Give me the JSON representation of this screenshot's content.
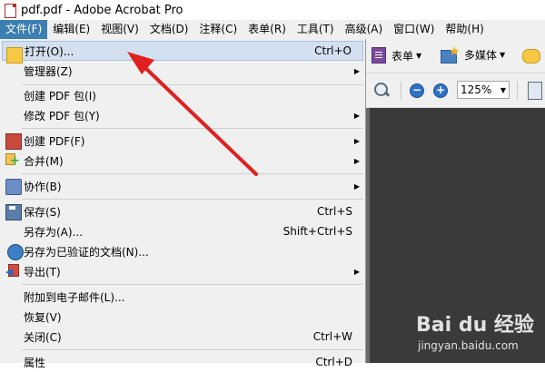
{
  "window": {
    "title": "pdf.pdf - Adobe Acrobat Pro"
  },
  "menubar": {
    "items": [
      {
        "label": "文件(F)"
      },
      {
        "label": "编辑(E)"
      },
      {
        "label": "视图(V)"
      },
      {
        "label": "文档(D)"
      },
      {
        "label": "注释(C)"
      },
      {
        "label": "表单(R)"
      },
      {
        "label": "工具(T)"
      },
      {
        "label": "高级(A)"
      },
      {
        "label": "窗口(W)"
      },
      {
        "label": "帮助(H)"
      }
    ]
  },
  "file_menu": {
    "items": [
      {
        "label": "打开(O)...",
        "shortcut": "Ctrl+O",
        "icon": "folder-icon"
      },
      {
        "label": "管理器(Z)",
        "submenu": true
      },
      {
        "label": "创建 PDF 包(I)"
      },
      {
        "label": "修改 PDF 包(Y)",
        "submenu": true
      },
      {
        "label": "创建 PDF(F)",
        "submenu": true,
        "icon": "create-pdf-icon"
      },
      {
        "label": "合并(M)",
        "submenu": true,
        "icon": "merge-icon"
      },
      {
        "label": "协作(B)",
        "submenu": true,
        "icon": "collaborate-icon"
      },
      {
        "label": "保存(S)",
        "shortcut": "Ctrl+S",
        "icon": "save-icon"
      },
      {
        "label": "另存为(A)...",
        "shortcut": "Shift+Ctrl+S"
      },
      {
        "label": "另存为已验证的文档(N)...",
        "icon": "certified-ribbon-icon"
      },
      {
        "label": "导出(T)",
        "submenu": true,
        "icon": "export-icon"
      },
      {
        "label": "附加到电子邮件(L)..."
      },
      {
        "label": "恢复(V)"
      },
      {
        "label": "关闭(C)",
        "shortcut": "Ctrl+W"
      },
      {
        "label": "属性",
        "shortcut": "Ctrl+D"
      }
    ],
    "submenu_arrow": "▶"
  },
  "toolbar": {
    "forms_label": "表单",
    "multimedia_label": "多媒体",
    "dropdown_caret": "▼",
    "zoom_value": "125%",
    "zoom_out": "−",
    "zoom_in": "+"
  },
  "watermark": {
    "logo": "Bai du 经验",
    "url": "jingyan.baidu.com"
  },
  "colors": {
    "menu_active": "#3c7fb1",
    "menu_highlight": "#d3e0ef",
    "document_background": "#3a3a3a",
    "annotation_arrow": "#e02020"
  }
}
